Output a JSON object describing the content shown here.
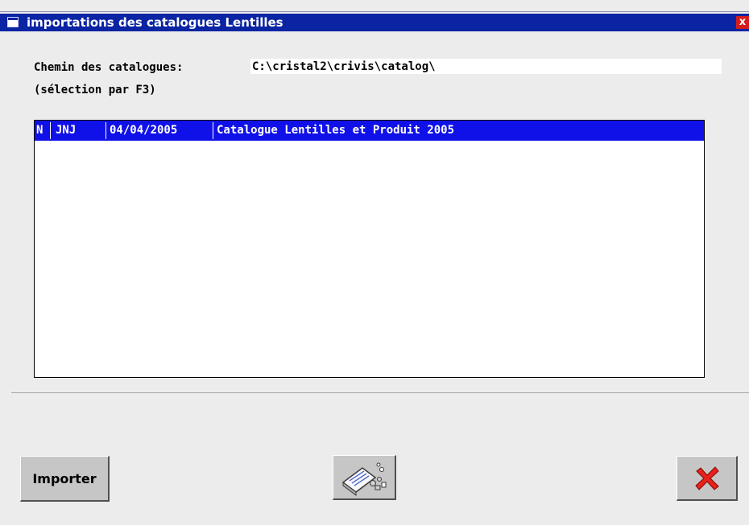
{
  "window": {
    "title": "importations des catalogues Lentilles",
    "close_glyph": "x"
  },
  "path": {
    "label": "Chemin des catalogues:",
    "value": "C:\\cristal2\\crivis\\catalog\\",
    "hint": "(sélection par F3)"
  },
  "catalogs": [
    {
      "flag": "N",
      "code": "JNJ",
      "date": "04/04/2005",
      "name": "Catalogue Lentilles et Produit 2005",
      "selected": true
    }
  ],
  "buttons": {
    "import_label": "Importer",
    "tool_icon": "catalog-tool-icon",
    "cancel_icon": "red-x-icon"
  },
  "colors": {
    "titlebar": "#0a24a3",
    "selection": "#1010e8",
    "cancel": "#e8211a"
  }
}
